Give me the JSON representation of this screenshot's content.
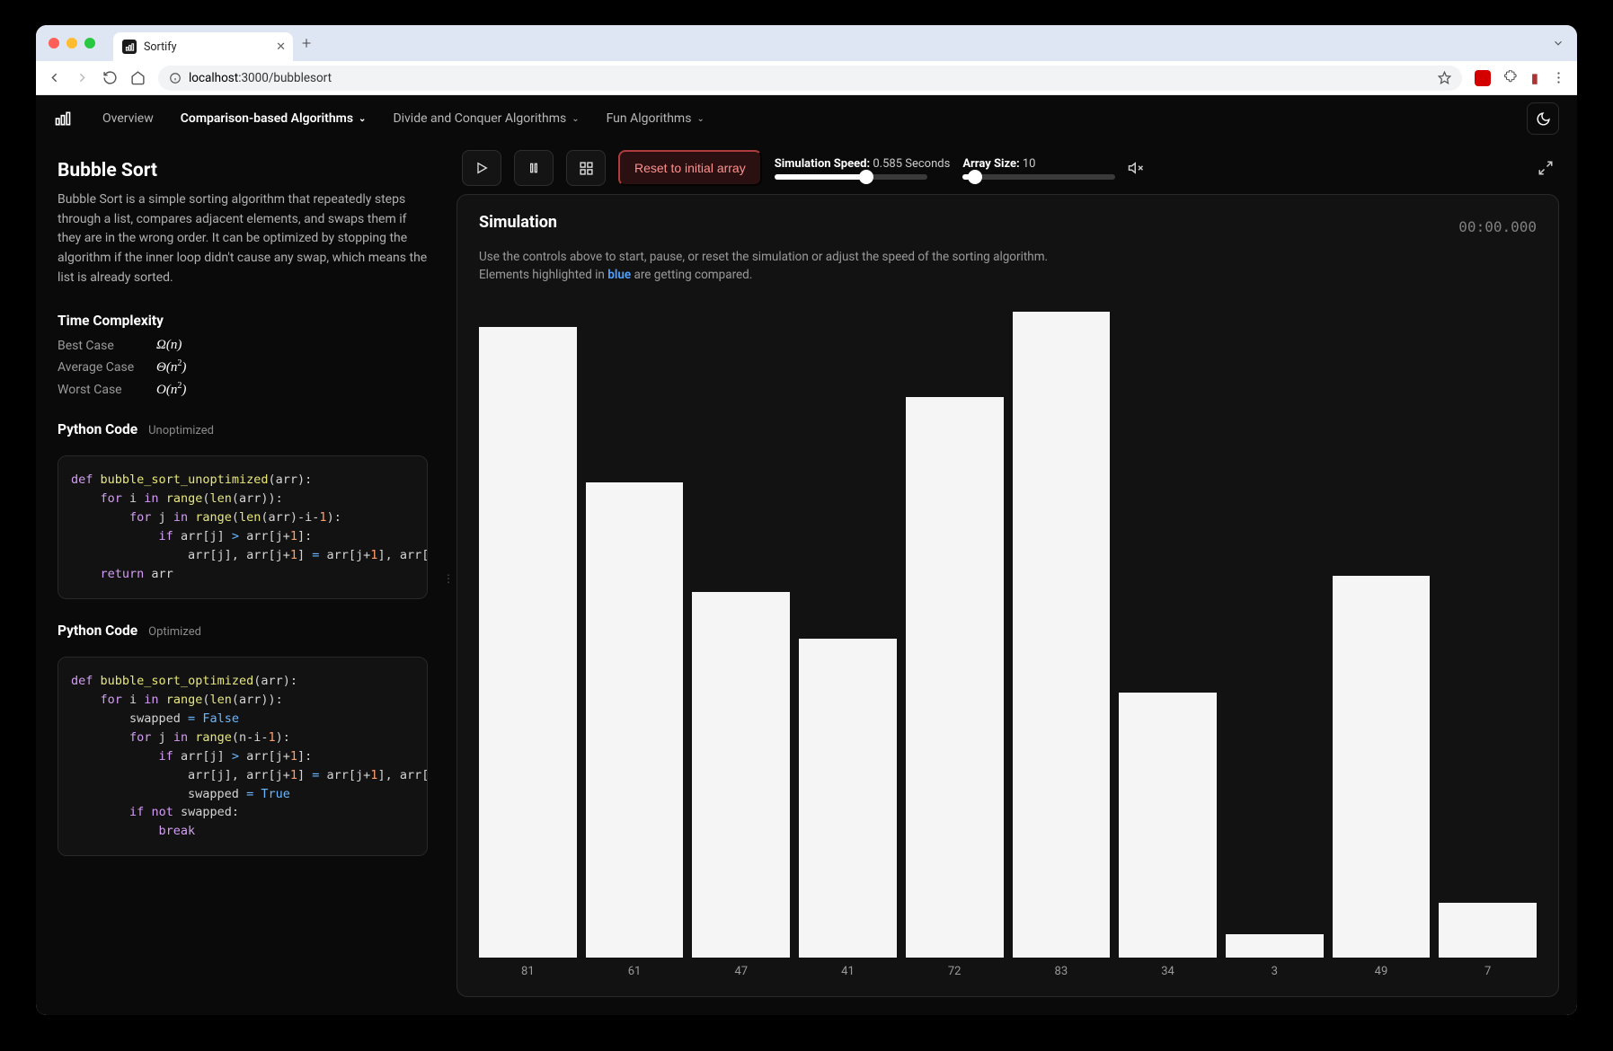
{
  "browser": {
    "tab_title": "Sortify",
    "url_host": "localhost",
    "url_path": ":3000/bubblesort"
  },
  "nav": {
    "items": [
      {
        "label": "Overview",
        "dropdown": false,
        "active": false
      },
      {
        "label": "Comparison-based Algorithms",
        "dropdown": true,
        "active": true
      },
      {
        "label": "Divide and Conquer Algorithms",
        "dropdown": true,
        "active": false
      },
      {
        "label": "Fun Algorithms",
        "dropdown": true,
        "active": false
      }
    ]
  },
  "left": {
    "title": "Bubble Sort",
    "description": "Bubble Sort is a simple sorting algorithm that repeatedly steps through a list, compares adjacent elements, and swaps them if they are in the wrong order. It can be optimized by stopping the algorithm if the inner loop didn't cause any swap, which means the list is already sorted.",
    "tc_title": "Time Complexity",
    "tc": [
      {
        "label": "Best Case",
        "value": "Ω(n)",
        "sup": ""
      },
      {
        "label": "Average Case",
        "value": "Θ(n",
        "sup": "2",
        "close": ")"
      },
      {
        "label": "Worst Case",
        "value": "O(n",
        "sup": "2",
        "close": ")"
      }
    ],
    "code_unopt_title": "Python Code",
    "code_unopt_variant": "Unoptimized",
    "code_opt_title": "Python Code",
    "code_opt_variant": "Optimized"
  },
  "controls": {
    "reset_label": "Reset to initial array",
    "speed_label": "Simulation Speed:",
    "speed_value": "0.585 Seconds",
    "speed_fill_pct": 60,
    "size_label": "Array Size:",
    "size_value": "10",
    "size_fill_pct": 8
  },
  "sim": {
    "title": "Simulation",
    "timer": "00:00.000",
    "desc_a": "Use the controls above to start, pause, or reset the simulation or adjust the speed of the sorting algorithm.",
    "desc_b": "Elements highlighted in ",
    "desc_blue": "blue",
    "desc_c": " are getting compared."
  },
  "chart_data": {
    "type": "bar",
    "categories": [
      "81",
      "61",
      "47",
      "41",
      "72",
      "83",
      "34",
      "3",
      "49",
      "7"
    ],
    "values": [
      81,
      61,
      47,
      41,
      72,
      83,
      34,
      3,
      49,
      7
    ],
    "ylim": [
      0,
      83
    ],
    "xlabel": "",
    "ylabel": ""
  }
}
